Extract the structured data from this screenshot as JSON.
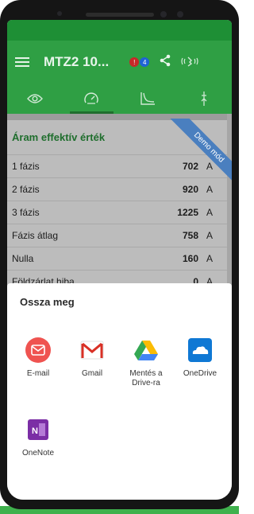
{
  "app": {
    "title": "MTZ2 10...",
    "badges": [
      {
        "text": "!",
        "color": "#c62828"
      },
      {
        "text": "4",
        "color": "#1e63d6"
      }
    ],
    "icons": [
      "menu-icon",
      "share-icon",
      "vibration-icon"
    ],
    "tabs": [
      "eye-icon",
      "gauge-icon",
      "curve-icon",
      "signal-icon"
    ],
    "active_tab": 1,
    "accent": "#2f9f44"
  },
  "card": {
    "title": "Áram effektív érték",
    "ribbon": "Demo mód",
    "rows": [
      {
        "label": "1 fázis",
        "value": "702",
        "unit": "A"
      },
      {
        "label": "2 fázis",
        "value": "920",
        "unit": "A"
      },
      {
        "label": "3 fázis",
        "value": "1225",
        "unit": "A"
      },
      {
        "label": "Fázis átlag",
        "value": "758",
        "unit": "A"
      },
      {
        "label": "Nulla",
        "value": "160",
        "unit": "A"
      },
      {
        "label": "Földzárlat hiba",
        "value": "0",
        "unit": "A"
      }
    ]
  },
  "share": {
    "title": "Ossza meg",
    "targets": [
      {
        "label": "E-mail",
        "icon": "email-icon",
        "color": "#ef5350"
      },
      {
        "label": "Gmail",
        "icon": "gmail-icon",
        "color": "#d93025"
      },
      {
        "label": "Mentés a Drive-ra",
        "icon": "google-drive-icon",
        "color": "#34a853"
      },
      {
        "label": "OneDrive",
        "icon": "onedrive-icon",
        "color": "#0f78d4"
      },
      {
        "label": "OneNote",
        "icon": "onenote-icon",
        "color": "#7b2ea5"
      }
    ]
  }
}
